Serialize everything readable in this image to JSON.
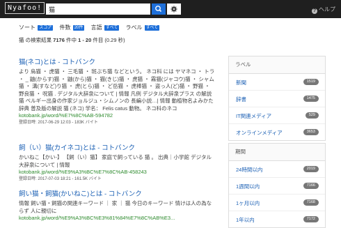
{
  "header": {
    "logo": "Nyafoo!",
    "search_value": "猫",
    "help_label": "ヘルプ"
  },
  "sortbar": {
    "sort_label": "ソート",
    "sort_value": "スコア",
    "count_label": "件数",
    "count_value": "20件",
    "lang_label": "言語",
    "lang_value": "すべて",
    "label_label": "ラベル",
    "label_value": "すべて"
  },
  "summary": {
    "prefix": "猫 の検索結果",
    "total": "7176",
    "mid": "件中",
    "range": "1 - 20",
    "suffix": "件目 (0.29 秒)"
  },
  "results": [
    {
      "title": "猫(ネコ)とは - コトバンク",
      "snippet": "より 烏猫 ・ 虎猫 ・ 三毛猫 ・ 斑ぶち猫 などという。 ネコ科 には ヤマネコ ・ トラ ・ _ 鼬(からす)猫 ・ 鼬(から)猫 ・ 猫(きじ)猫 ・ 虎猫 ・ 霧猫(ジャコウ)猫 ・ シャム猫 ・ 溝(すなど)り猫 ・ 虎(とら)猫 ・ ど岳猫 ・ 虎棒猫 ・ 盗っ人(ど)猫 ・ 野猫 ・ 野良猫 ・ 呪猫 . デジタル大辞泉について | 情報 凡例 デジタル大辞泉プラス の解説 猫 ベルギー出身の作家ジョルジュ・シムノンの 長編小説…| 情報 動植物名よみかた辞典 普及版の解説 猫 (ネコ) 学名： Felis catus 動物。 ネコ科のネコ",
      "url": "kotobank.jp/word/%E7%8C%AB-594782",
      "meta": "登録日時: 2017-06-29 12:03 - 183K バイト"
    },
    {
      "title": "飼（い）猫(カイネコ)とは - コトバンク",
      "snippet": "かいねこ【かい‐】 【飼（い）猫】 家庭で飼っている 猫 。 出典｜小学館 デジタル大辞泉について | 情報",
      "url": "kotobank.jp/word/%E9%A3%BC%E7%8C%AB-458243",
      "meta": "登録日時: 2017-07-03 18:21 - 161.5K バイト"
    },
    {
      "title": "飼い猫・飼猫(かいねこ)とは - コトバンク",
      "snippet": "情報 飼い猫・飼猫の関連キーワード ｜ 家 ｜ 猫 今日のキーワード 情けは人の為ならず 人に親切に",
      "url": "kotobank.jp/word/%E9%A3%BC%E3%81%84%E7%8C%AB%E3...",
      "meta": ""
    }
  ],
  "label_panel": {
    "title": "ラベル",
    "items": [
      {
        "label": "新聞",
        "count": "1519"
      },
      {
        "label": "辞書",
        "count": "1475"
      },
      {
        "label": "IT関連メディア",
        "count": "529"
      },
      {
        "label": "オンラインメディア",
        "count": "3653"
      }
    ]
  },
  "period_panel": {
    "title": "期間",
    "items": [
      {
        "label": "24時間以内",
        "count": "2019"
      },
      {
        "label": "1週間以内",
        "count": "7166"
      },
      {
        "label": "1ヶ月以内",
        "count": "7168"
      },
      {
        "label": "1年以内",
        "count": "7172"
      }
    ]
  }
}
